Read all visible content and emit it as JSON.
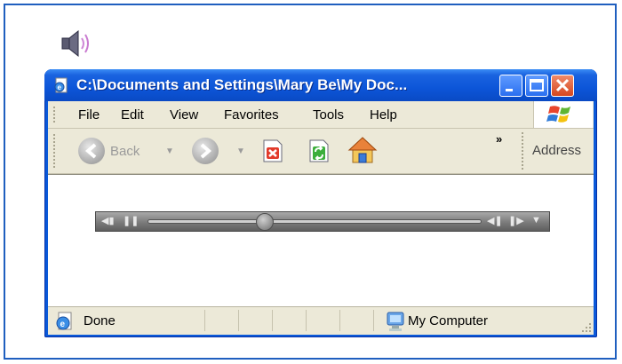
{
  "window": {
    "title": "C:\\Documents and Settings\\Mary Be\\My Doc..."
  },
  "menu": {
    "items": [
      "File",
      "Edit",
      "View",
      "Favorites",
      "Tools",
      "Help"
    ]
  },
  "toolbar": {
    "back_label": "Back",
    "more_label": "»",
    "address_label": "Address"
  },
  "player": {
    "progress": 0.35
  },
  "status": {
    "text": "Done",
    "zone": "My Computer"
  },
  "colors": {
    "titlebar": "#0c55d8",
    "frame": "#0a59d9",
    "chrome": "#ece9d8",
    "player": "#7b7b7b"
  },
  "icons": [
    "speaker-icon",
    "ie-page-icon",
    "minimize-icon",
    "maximize-icon",
    "close-icon",
    "windows-logo-icon",
    "back-arrow-icon",
    "forward-arrow-icon",
    "stop-icon",
    "refresh-icon",
    "home-icon",
    "done-page-icon",
    "my-computer-icon"
  ]
}
